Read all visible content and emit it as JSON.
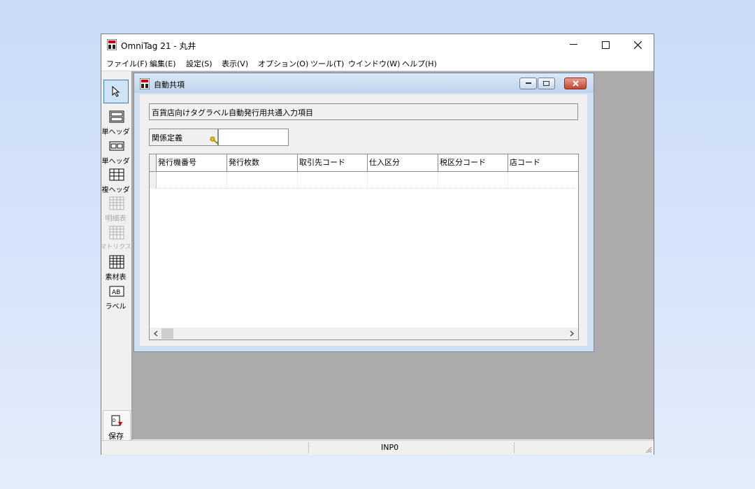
{
  "app": {
    "title": "OmniTag 21 - 丸井",
    "menus": [
      "ファイル(F)",
      "編集(E)",
      "設定(S)",
      "表示(V)",
      "オプション(O)",
      "ツール(T)",
      "ウインドウ(W)",
      "ヘルプ(H)"
    ]
  },
  "toolbar": {
    "tools": [
      {
        "label": "単ヘッダ",
        "icon": "header-single-icon",
        "enabled": true
      },
      {
        "label": "単ヘッダ",
        "icon": "header-box-icon",
        "enabled": true
      },
      {
        "label": "複ヘッダ",
        "icon": "header-grid-icon",
        "enabled": true
      },
      {
        "label": "明細表",
        "icon": "detail-table-icon",
        "enabled": false
      },
      {
        "label": "マトリクス",
        "icon": "matrix-icon",
        "enabled": false
      },
      {
        "label": "素材表",
        "icon": "material-table-icon",
        "enabled": true
      },
      {
        "label": "ラベル",
        "icon": "label-ab-icon",
        "enabled": true
      }
    ],
    "save_label": "保存"
  },
  "child": {
    "title": "自動共項",
    "description": "百貨店向けタグラベル自動発行用共通入力項目",
    "relation_label": "関係定義",
    "relation_value": "",
    "columns": [
      "発行機番号",
      "発行枚数",
      "取引先コード",
      "仕入区分",
      "税区分コード",
      "店コード"
    ]
  },
  "status": {
    "text": "INP0"
  }
}
